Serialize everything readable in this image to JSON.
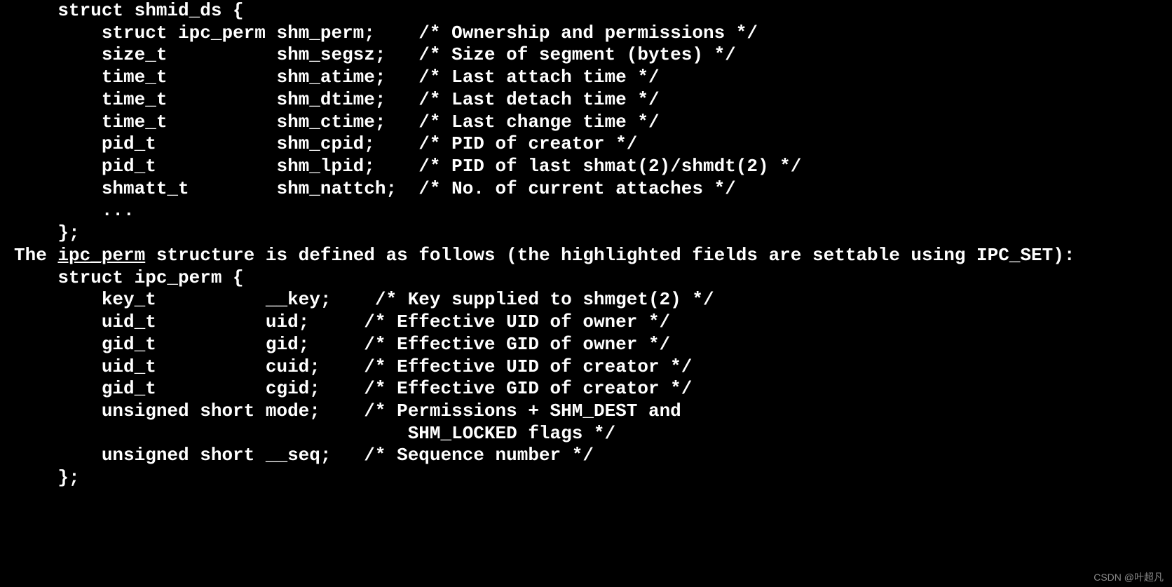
{
  "struct1": {
    "header": "    struct shmid_ds {",
    "lines": [
      "        struct ipc_perm shm_perm;    /* Ownership and permissions */",
      "        size_t          shm_segsz;   /* Size of segment (bytes) */",
      "        time_t          shm_atime;   /* Last attach time */",
      "        time_t          shm_dtime;   /* Last detach time */",
      "        time_t          shm_ctime;   /* Last change time */",
      "        pid_t           shm_cpid;    /* PID of creator */",
      "        pid_t           shm_lpid;    /* PID of last shmat(2)/shmdt(2) */",
      "        shmatt_t        shm_nattch;  /* No. of current attaches */",
      "        ...",
      "    };"
    ]
  },
  "description": {
    "prefix": "The ",
    "underlined": "ipc_perm",
    "middle": " structure is defined as follows (the highlighted fields are settable using ",
    "bold1": "IPC_SET",
    "suffix": "):"
  },
  "struct2": {
    "header": "    struct ipc_perm {",
    "line1_pre": "        key_t          __key;    /* Key supplied to shmget(2) */",
    "line2_pre": "        uid_t          ",
    "line2_bold": "uid",
    "line2_post": ";     /* Effective UID of owner */",
    "line3_pre": "        gid_t          ",
    "line3_bold": "gid",
    "line3_post": ";     /* Effective GID of owner */",
    "line4": "        uid_t          cuid;    /* Effective UID of creator */",
    "line5": "        gid_t          cgid;    /* Effective GID of creator */",
    "line6_pre": "        unsigned short ",
    "line6_bold": "mode",
    "line6_post": ";    /* ",
    "line6_bold2": "Permissions",
    "line6_post2": " + SHM_DEST and",
    "line7": "                                    SHM_LOCKED flags */",
    "line8": "        unsigned short __seq;   /* Sequence number */",
    "footer": "    };"
  },
  "watermark": "CSDN @叶超凡"
}
